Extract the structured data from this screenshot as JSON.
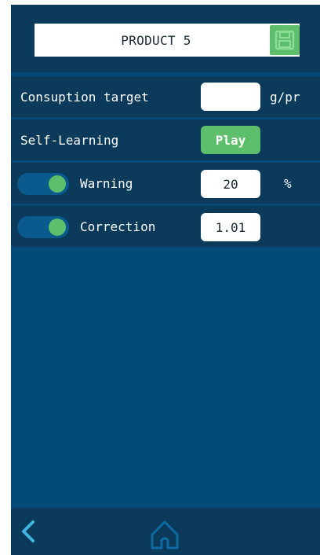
{
  "header": {
    "product_name": "PRODUCT 5",
    "save_icon": "floppy-disk-icon"
  },
  "rows": {
    "consumption": {
      "label": "Consuption target",
      "value": "",
      "unit": "g/pr"
    },
    "self_learning": {
      "label": "Self-Learning",
      "button_label": "Play"
    },
    "warning": {
      "label": "Warning",
      "value": "20",
      "unit": "%",
      "toggle_on": true
    },
    "correction": {
      "label": "Correction",
      "value": "1.01",
      "toggle_on": true
    }
  },
  "footer": {
    "back_icon": "chevron-left-icon",
    "home_icon": "home-icon"
  },
  "colors": {
    "background": "#044a76",
    "panel": "#0b3a5b",
    "accent_green": "#5dbe6b",
    "accent_cyan": "#3fb4e0"
  }
}
